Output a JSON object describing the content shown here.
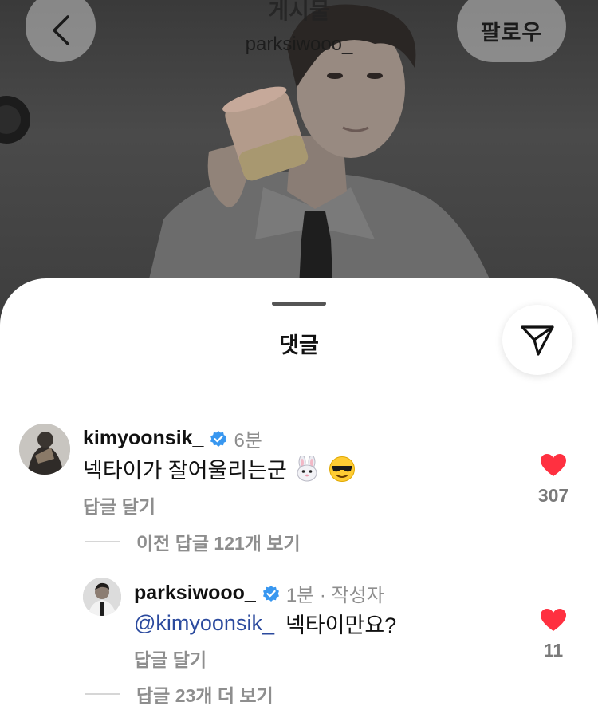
{
  "header": {
    "title": "게시물",
    "username": "parksiwooo_",
    "follow_label": "팔로우"
  },
  "sheet": {
    "title": "댓글"
  },
  "comments": [
    {
      "username": "kimyoonsik_",
      "verified": true,
      "time": "6분",
      "text": "넥타이가 잘어울리는군",
      "emojis": [
        "rabbit-face-icon",
        "sunglasses-face-icon"
      ],
      "reply_label": "답글 달기",
      "likes": "307",
      "liked": true,
      "view_previous_replies": "이전 답글 121개 보기"
    }
  ],
  "replies": [
    {
      "username": "parksiwooo_",
      "verified": true,
      "time": "1분 · 작성자",
      "mention": "@kimyoonsik_",
      "text": "넥타이만요?",
      "reply_label": "답글 달기",
      "likes": "11",
      "liked": true,
      "view_more_replies": "답글 23개 더 보기"
    }
  ],
  "colors": {
    "like_red": "#ff3040",
    "verified_blue": "#3897f0",
    "mention_blue": "#2b4a9e",
    "meta_gray": "#8e8e8e"
  }
}
